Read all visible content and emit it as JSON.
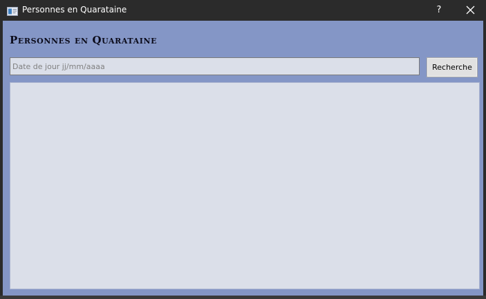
{
  "window": {
    "title": "Personnes en Quarataine",
    "help_label": "?",
    "close_icon": "close-icon",
    "app_icon": "window-app-icon"
  },
  "main": {
    "heading": "Personnes en Quarataine",
    "date_input": {
      "value": "",
      "placeholder": "Date de jour jj/mm/aaaa"
    },
    "search_button_label": "Recherche",
    "results": []
  },
  "colors": {
    "titlebar_bg": "#2b2b2b",
    "client_bg": "#8496c6",
    "field_bg": "#dbdfe9",
    "button_bg": "#e1e1e1",
    "heading_text": "#0b0b1a"
  }
}
